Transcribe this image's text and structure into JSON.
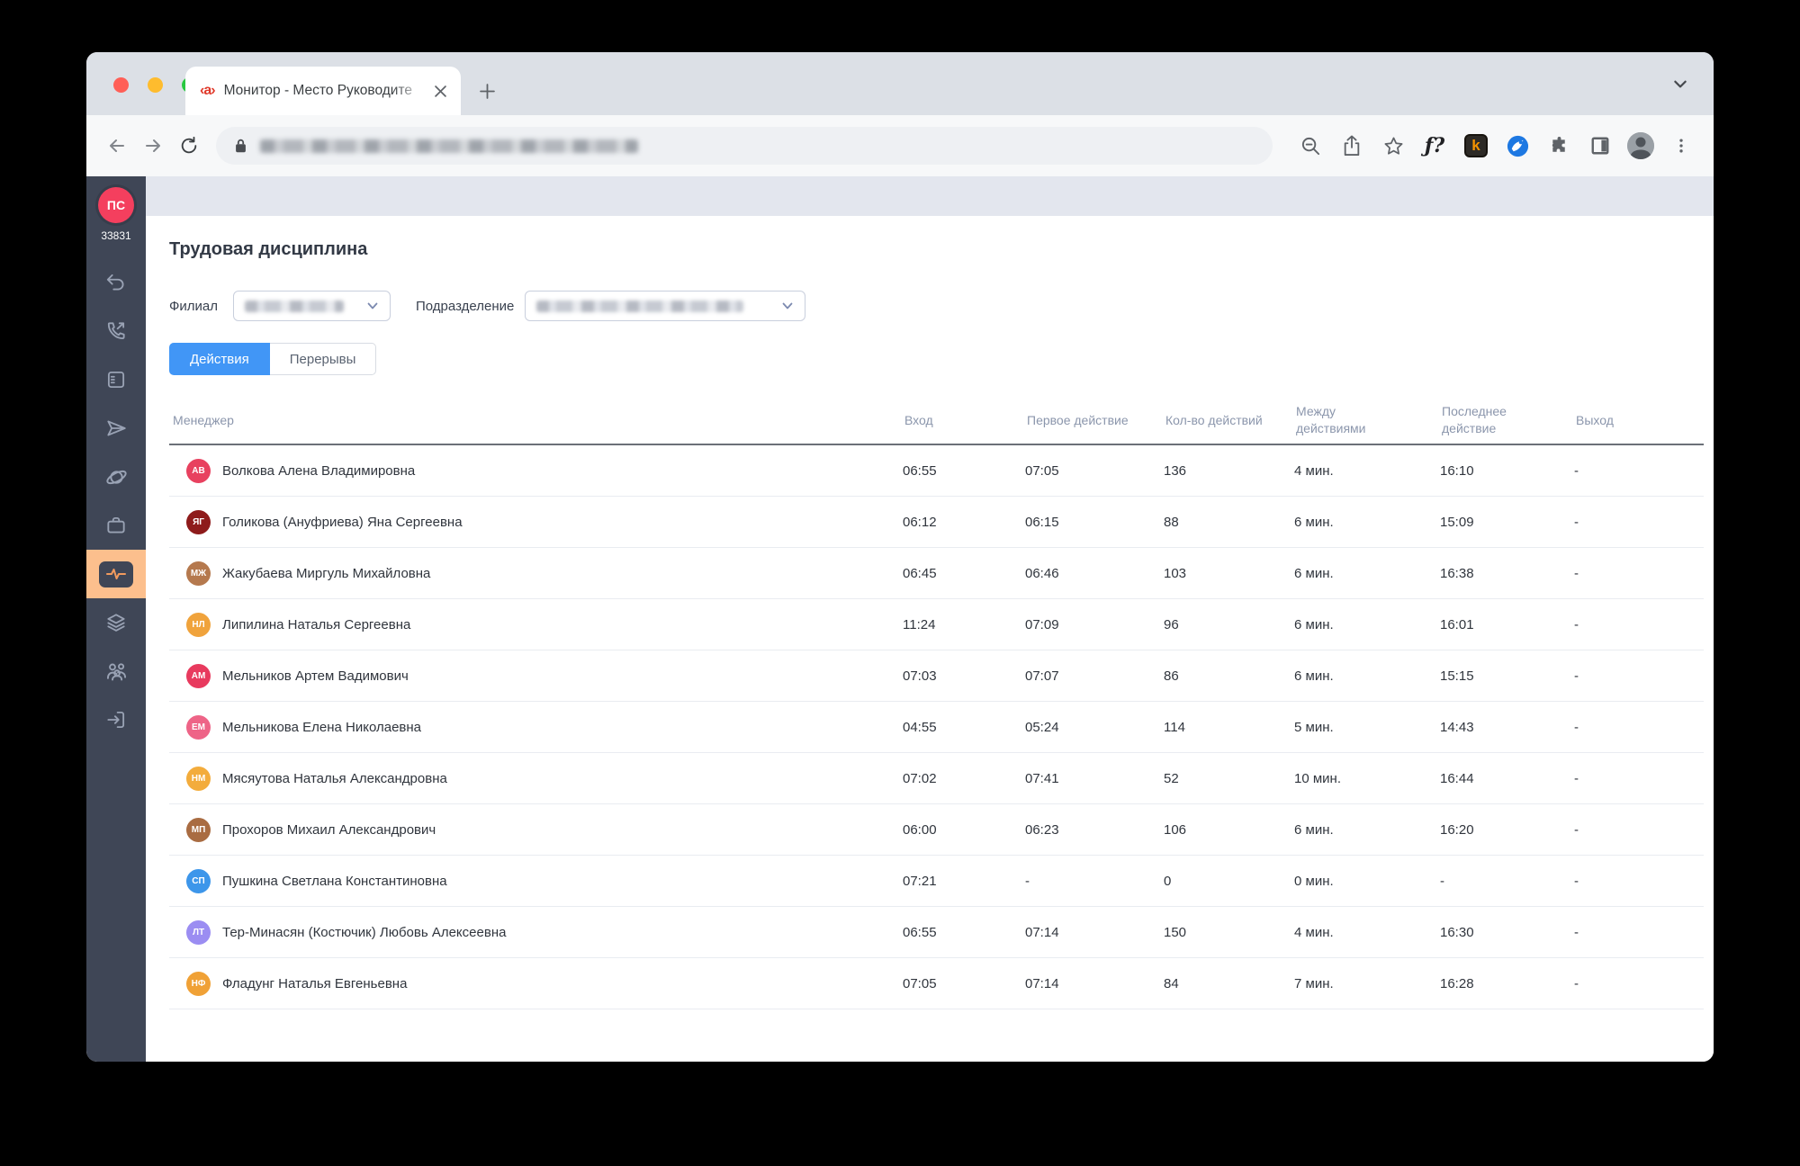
{
  "colors": {
    "accent_blue": "#4196f6",
    "sidebar_bg": "#3f4656",
    "sidebar_active_bg": "#fcbf8d",
    "pulse_orange": "#f29b5e",
    "user_avatar_pink": "#f43f5e",
    "topstrip_gray": "#e3e6ee",
    "header_text": "#8b96ac"
  },
  "browser": {
    "tab": {
      "favicon_text": "‹a›",
      "title": "Монитор - Место Руководите"
    },
    "new_tab_label": "+",
    "extensions": {
      "fn_label": "ƒ?",
      "k_label": "k"
    },
    "icon_names": [
      "back-icon",
      "forward-icon",
      "reload-icon",
      "lock-icon",
      "zoom-out-icon",
      "share-icon",
      "star-icon",
      "puzzle-icon",
      "panel-icon",
      "profile-avatar",
      "menu-icon",
      "chevron-down-icon"
    ]
  },
  "sidebar": {
    "user_initials": "ПС",
    "user_id": "33831",
    "icon_names": [
      "undo-icon",
      "phone-outgoing-icon",
      "notes-icon",
      "send-icon",
      "orbit-icon",
      "briefcase-icon",
      "activity-icon",
      "layers-icon",
      "team-icon",
      "logout-icon"
    ],
    "active_icon": "activity-icon"
  },
  "page": {
    "title": "Трудовая дисциплина",
    "filters": {
      "branch_label": "Филиал",
      "department_label": "Подразделение"
    },
    "tabs": {
      "actions_label": "Действия",
      "breaks_label": "Перерывы",
      "active": "Действия"
    },
    "table": {
      "columns": [
        "Менеджер",
        "Вход",
        "Первое действие",
        "Кол-во действий",
        "Между\nдействиями",
        "Последнее\nдействие",
        "Выход"
      ],
      "rows": [
        {
          "initials": "АВ",
          "color": "#e8415f",
          "name": "Волкова Алена Владимировна",
          "entry": "06:55",
          "first": "07:05",
          "count": "136",
          "between": "4 мин.",
          "last": "16:10",
          "exit": "-"
        },
        {
          "initials": "ЯГ",
          "color": "#8e1b1b",
          "name": "Голикова (Ануфриева) Яна Сергеевна",
          "entry": "06:12",
          "first": "06:15",
          "count": "88",
          "between": "6 мин.",
          "last": "15:09",
          "exit": "-"
        },
        {
          "initials": "МЖ",
          "color": "#b5794e",
          "name": "Жакубаева Миргуль Михайловна",
          "entry": "06:45",
          "first": "06:46",
          "count": "103",
          "between": "6 мин.",
          "last": "16:38",
          "exit": "-"
        },
        {
          "initials": "НЛ",
          "color": "#f0a33c",
          "name": "Липилина Наталья Сергеевна",
          "entry": "11:24",
          "first": "07:09",
          "count": "96",
          "between": "6 мин.",
          "last": "16:01",
          "exit": "-"
        },
        {
          "initials": "АМ",
          "color": "#e83a5e",
          "name": "Мельников Артем Вадимович",
          "entry": "07:03",
          "first": "07:07",
          "count": "86",
          "between": "6 мин.",
          "last": "15:15",
          "exit": "-"
        },
        {
          "initials": "ЕМ",
          "color": "#ee6487",
          "name": "Мельникова Елена Николаевна",
          "entry": "04:55",
          "first": "05:24",
          "count": "114",
          "between": "5 мин.",
          "last": "14:43",
          "exit": "-"
        },
        {
          "initials": "НМ",
          "color": "#f3ac3c",
          "name": "Мясяутова Наталья Александровна",
          "entry": "07:02",
          "first": "07:41",
          "count": "52",
          "between": "10 мин.",
          "last": "16:44",
          "exit": "-"
        },
        {
          "initials": "МП",
          "color": "#a96c42",
          "name": "Прохоров Михаил Александрович",
          "entry": "06:00",
          "first": "06:23",
          "count": "106",
          "between": "6 мин.",
          "last": "16:20",
          "exit": "-"
        },
        {
          "initials": "СП",
          "color": "#3d96ea",
          "name": "Пушкина Светлана Константиновна",
          "entry": "07:21",
          "first": "-",
          "count": "0",
          "between": "0 мин.",
          "last": "-",
          "exit": "-"
        },
        {
          "initials": "ЛТ",
          "color": "#9b8df2",
          "name": "Тер-Минасян (Костючик) Любовь Алексеевна",
          "entry": "06:55",
          "first": "07:14",
          "count": "150",
          "between": "4 мин.",
          "last": "16:30",
          "exit": "-"
        },
        {
          "initials": "НФ",
          "color": "#f0a136",
          "name": "Фладунг Наталья Евгеньевна",
          "entry": "07:05",
          "first": "07:14",
          "count": "84",
          "between": "7 мин.",
          "last": "16:28",
          "exit": "-"
        }
      ]
    }
  }
}
